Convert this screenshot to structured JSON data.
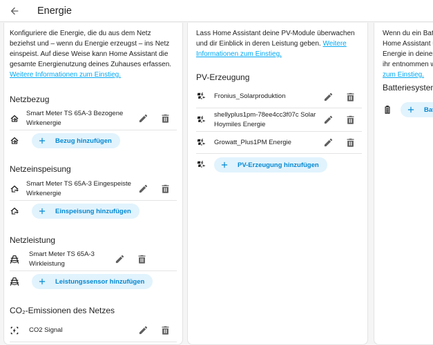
{
  "header": {
    "title": "Energie",
    "back_icon": "arrow-left-icon"
  },
  "grid_card": {
    "description": "Konfiguriere die Energie, die du aus dem Netz beziehst und – wenn du Energie erzeugst – ins Netz einspeist. Auf diese Weise kann Home Assistant die gesamte Energienutzung deines Zuhauses erfassen. ",
    "link": "Weitere Informationen zum Einstieg.",
    "sections": {
      "consumption": {
        "title": "Netzbezug",
        "items": [
          {
            "label": "Smart Meter TS 65A-3 Bezogene Wirkenergie"
          }
        ],
        "add_label": "Bezug hinzufügen"
      },
      "return": {
        "title": "Netzeinspeisung",
        "items": [
          {
            "label": "Smart Meter TS 65A-3 Eingespeiste Wirkenergie"
          }
        ],
        "add_label": "Einspeisung hinzufügen"
      },
      "power": {
        "title": "Netzleistung",
        "items": [
          {
            "label": "Smart Meter TS 65A-3 Wirkleistung"
          }
        ],
        "add_label": "Leistungssensor hinzufügen"
      },
      "co2": {
        "title": "CO₂-Emissionen des Netzes",
        "items": [
          {
            "label": "CO2 Signal"
          }
        ]
      }
    }
  },
  "solar_card": {
    "description": "Lass Home Assistant deine PV-Module überwachen und dir Einblick in deren Leistung geben. ",
    "link": "Weitere Informationen zum Einstieg.",
    "section_title": "PV-Erzeugung",
    "items": [
      {
        "label": "Fronius_Solarproduktion"
      },
      {
        "label": "shellyplus1pm-78ee4cc3f07c Solar Hoymiles Energie"
      },
      {
        "label": "Growatt_Plus1PM Energie"
      }
    ],
    "add_label": "PV-Erzeugung hinzufügen"
  },
  "battery_card": {
    "description": "Wenn du ein Batteriesystem hast, kannst du Home Assistant überwachen lassen, wie viel Energie in deiner Batterie gespeichert und aus ihr entnommen wurde. ",
    "link": "Weitere Informationen zum Einstieg.",
    "section_title": "Batteriesystem",
    "add_label": "Batteriesystem hinzufügen"
  },
  "colors": {
    "accent": "#03a9f4",
    "pill_bg": "#e1f3fd",
    "pill_text": "#0288d1",
    "text": "#212121"
  }
}
